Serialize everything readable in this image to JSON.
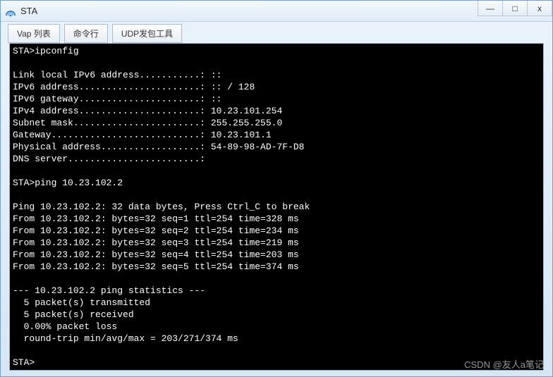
{
  "window": {
    "title": "STA",
    "icon_name": "network-icon"
  },
  "controls": {
    "minimize": "—",
    "maximize": "□",
    "close": "x"
  },
  "tabs": [
    {
      "id": "vap-list",
      "label": "Vap 列表"
    },
    {
      "id": "cmd",
      "label": "命令行"
    },
    {
      "id": "udp",
      "label": "UDP发包工具"
    }
  ],
  "terminal": {
    "lines": [
      "STA>ipconfig",
      "",
      "Link local IPv6 address...........: ::",
      "IPv6 address......................: :: / 128",
      "IPv6 gateway......................: ::",
      "IPv4 address......................: 10.23.101.254",
      "Subnet mask.......................: 255.255.255.0",
      "Gateway...........................: 10.23.101.1",
      "Physical address..................: 54-89-98-AD-7F-D8",
      "DNS server........................:",
      "",
      "STA>ping 10.23.102.2",
      "",
      "Ping 10.23.102.2: 32 data bytes, Press Ctrl_C to break",
      "From 10.23.102.2: bytes=32 seq=1 ttl=254 time=328 ms",
      "From 10.23.102.2: bytes=32 seq=2 ttl=254 time=234 ms",
      "From 10.23.102.2: bytes=32 seq=3 ttl=254 time=219 ms",
      "From 10.23.102.2: bytes=32 seq=4 ttl=254 time=203 ms",
      "From 10.23.102.2: bytes=32 seq=5 ttl=254 time=374 ms",
      "",
      "--- 10.23.102.2 ping statistics ---",
      "  5 packet(s) transmitted",
      "  5 packet(s) received",
      "  0.00% packet loss",
      "  round-trip min/avg/max = 203/271/374 ms",
      "",
      "STA>"
    ]
  },
  "watermark": "CSDN @友人a笔记"
}
